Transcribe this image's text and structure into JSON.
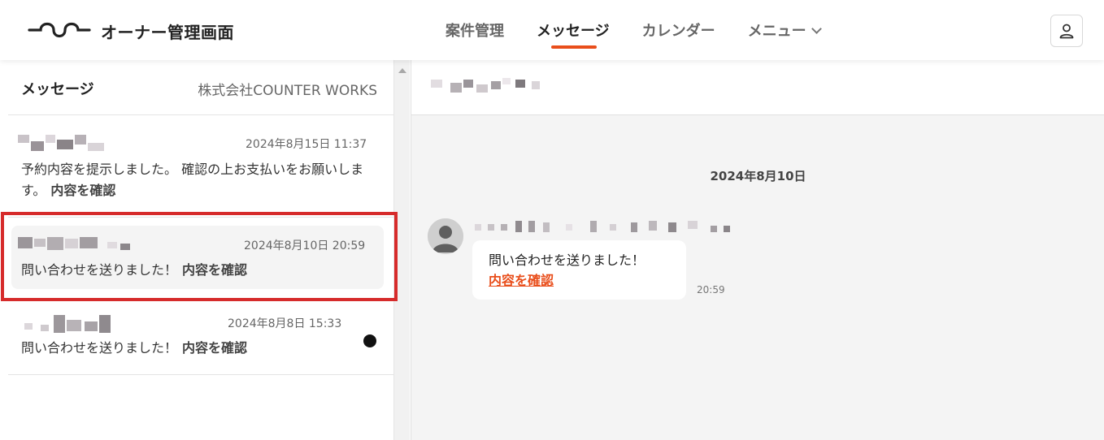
{
  "header": {
    "app_title": "オーナー管理画面",
    "nav": [
      {
        "label": "案件管理",
        "active": false
      },
      {
        "label": "メッセージ",
        "active": true
      },
      {
        "label": "カレンダー",
        "active": false
      },
      {
        "label": "メニュー",
        "active": false
      }
    ],
    "accent_color": "#e94e1b"
  },
  "sidebar": {
    "title": "メッセージ",
    "company": "株式会社COUNTER WORKS",
    "threads": [
      {
        "date": "2024年8月15日 11:37",
        "message": "予約内容を提示しました。 確認の上お支払いをお願いします。",
        "link": "内容を確認",
        "unread": false
      },
      {
        "date": "2024年8月10日 20:59",
        "message": "問い合わせを送りました！",
        "link": "内容を確認",
        "unread": false,
        "selected": true
      },
      {
        "date": "2024年8月8日 15:33",
        "message": "問い合わせを送りました！",
        "link": "内容を確認",
        "unread": true
      }
    ]
  },
  "conversation": {
    "date_separator": "2024年8月10日",
    "message": {
      "text": "問い合わせを送りました！",
      "link": "内容を確認",
      "time": "20:59"
    }
  }
}
